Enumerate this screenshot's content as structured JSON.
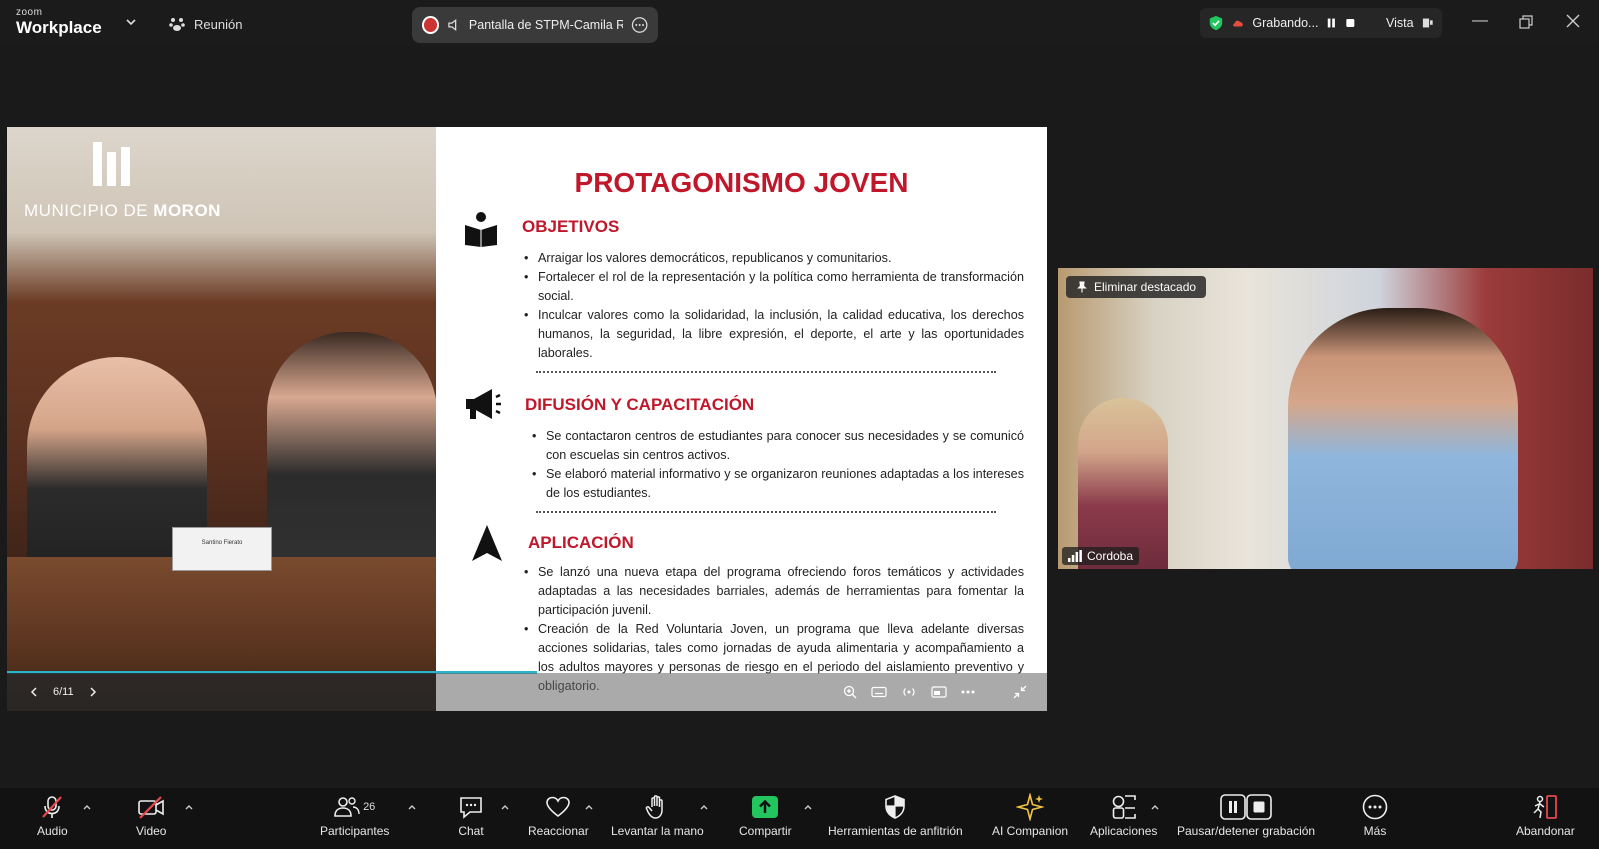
{
  "app": {
    "brand_top": "zoom",
    "brand_bottom": "Workplace",
    "meeting_label": "Reunión"
  },
  "share": {
    "label": "Pantalla de STPM-Camila Rc"
  },
  "recording": {
    "label": "Grabando...",
    "view_label": "Vista"
  },
  "slide": {
    "logo_text_light": "MUNICIPIO DE ",
    "logo_text_bold": "MORON",
    "nameplate": "Santino Fierato",
    "title": "PROTAGONISMO JOVEN",
    "sections": [
      {
        "heading": "OBJETIVOS",
        "icon": "book-reader-icon",
        "bullets": [
          "Arraigar los valores democráticos, republicanos y comunitarios.",
          "Fortalecer el rol de la representación y la política como herramienta de transformación social.",
          "Inculcar valores como la solidaridad, la inclusión, la calidad educativa, los derechos humanos, la seguridad, la libre expresión, el deporte, el arte y las oportunidades laborales."
        ]
      },
      {
        "heading": "DIFUSIÓN Y CAPACITACIÓN",
        "icon": "megaphone-icon",
        "bullets": [
          "Se contactaron centros de estudiantes para conocer sus necesidades y se comunicó con escuelas sin centros activos.",
          "Se elaboró material informativo y se organizaron reuniones adaptadas a los intereses de los estudiantes."
        ]
      },
      {
        "heading": "APLICACIÓN",
        "icon": "navigation-arrow-icon",
        "bullets": [
          "Se lanzó una nueva etapa del programa ofreciendo foros temáticos y actividades adaptadas a las necesidades barriales, además de herramientas para fomentar la participación juvenil.",
          "Creación de la Red Voluntaria Joven, un programa que lleva adelante diversas acciones solidarias, tales como jornadas de ayuda alimentaria y acompañamiento a los adultos mayores y personas de riesgo en el periodo del aislamiento preventivo y obligatorio."
        ]
      }
    ],
    "page_indicator": "6/11"
  },
  "video": {
    "pin_label": "Eliminar destacado",
    "participant_name": "Cordoba"
  },
  "toolbar": {
    "audio": "Audio",
    "video": "Video",
    "participants": "Participantes",
    "participants_count": "26",
    "chat": "Chat",
    "react": "Reaccionar",
    "raise_hand": "Levantar la mano",
    "share": "Compartir",
    "host_tools": "Herramientas de anfitrión",
    "ai_companion": "AI Companion",
    "apps": "Aplicaciones",
    "pause_recording": "Pausar/detener grabación",
    "more": "Más",
    "leave": "Abandonar"
  },
  "colors": {
    "accent_red": "#c0182b",
    "share_green": "#22c55e",
    "progress": "#2bb3c9"
  }
}
